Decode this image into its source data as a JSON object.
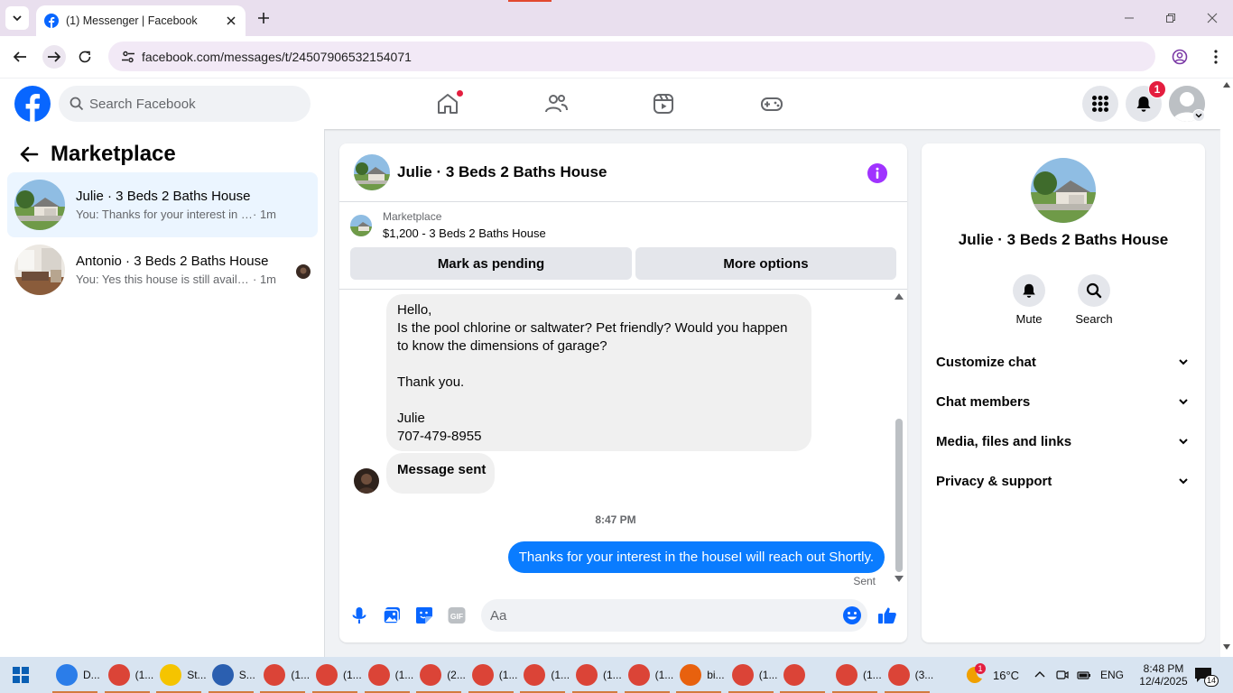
{
  "browser": {
    "tab_title": "(1) Messenger | Facebook",
    "url": "facebook.com/messages/t/24507906532154071"
  },
  "facebook": {
    "search_placeholder": "Search Facebook",
    "notification_count": "1"
  },
  "left_panel": {
    "title": "Marketplace",
    "conversations": [
      {
        "name": "Julie · 3 Beds 2 Baths House",
        "preview": "You: Thanks for your interest in the h...",
        "time": "· 1m"
      },
      {
        "name": "Antonio · 3 Beds 2 Baths House",
        "preview": "You: Yes this house is still available...",
        "time": "· 1m"
      }
    ]
  },
  "chat": {
    "title": "Julie · 3 Beds 2 Baths House",
    "marketplace_label": "Marketplace",
    "listing": "$1,200 - 3 Beds 2 Baths House",
    "mark_pending": "Mark as pending",
    "more_options": "More options",
    "incoming_lines": [
      "Hello,",
      "Is the pool chlorine or saltwater? Pet friendly? Would you happen",
      "to know the dimensions of garage?",
      "",
      "Thank you.",
      "",
      "Julie",
      "707-479-8955"
    ],
    "system_message": "Message sent",
    "timestamp": "8:47 PM",
    "outgoing_message": "Thanks for your interest in the houseI will reach out Shortly.",
    "status": "Sent",
    "composer_placeholder": "Aa"
  },
  "right_panel": {
    "name": "Julie · 3 Beds 2 Baths House",
    "mute": "Mute",
    "search": "Search",
    "sections": [
      "Customize chat",
      "Chat members",
      "Media, files and links",
      "Privacy & support"
    ]
  },
  "taskbar": {
    "apps": [
      {
        "label": "D...",
        "color": "#2b7de9"
      },
      {
        "label": "(1...",
        "color": "#db4437"
      },
      {
        "label": "St...",
        "color": "#f5c400"
      },
      {
        "label": "S...",
        "color": "#2b5fb0"
      },
      {
        "label": "(1...",
        "color": "#db4437"
      },
      {
        "label": "(1...",
        "color": "#db4437"
      },
      {
        "label": "(1...",
        "color": "#db4437"
      },
      {
        "label": "(2...",
        "color": "#db4437"
      },
      {
        "label": "(1...",
        "color": "#db4437"
      },
      {
        "label": "(1...",
        "color": "#db4437"
      },
      {
        "label": "(1...",
        "color": "#db4437"
      },
      {
        "label": "(1...",
        "color": "#db4437"
      },
      {
        "label": "bi...",
        "color": "#e8610e"
      },
      {
        "label": "(1...",
        "color": "#db4437"
      },
      {
        "label": "",
        "color": "#db4437"
      },
      {
        "label": "(1...",
        "color": "#db4437"
      },
      {
        "label": "(3...",
        "color": "#db4437"
      }
    ],
    "weather_badge": "1",
    "temperature": "16°C",
    "language": "ENG",
    "time": "8:48 PM",
    "date": "12/4/2025",
    "notifications": "14"
  },
  "colors": {
    "brand": "#0866ff",
    "outgoing_bubble": "#0a7cff",
    "messenger_purple": "#a033ff"
  }
}
